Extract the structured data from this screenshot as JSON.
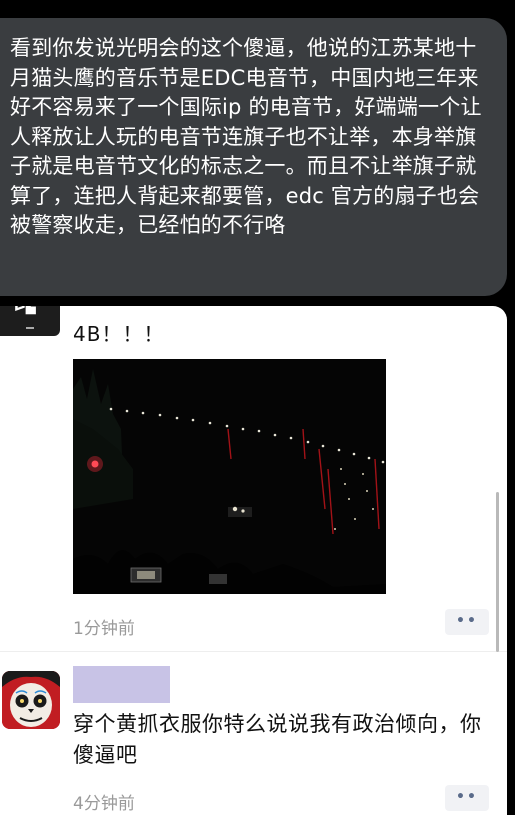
{
  "speech_bubble": {
    "text": "看到你发说光明会的这个傻逼，他说的江苏某地十月猫头鹰的音乐节是EDC电音节，中国内地三年来好不容易来了一个国际ip 的电音节，好端端一个让人释放让人玩的电音节连旗子也不让举，本身举旗子就是电音节文化的标志之一。而且不让举旗子就算了，连把人背起来都要管，edc 官方的扇子也会被警察收走，已经怕的不行咯"
  },
  "comments": [
    {
      "text": "4B！！！",
      "time": "1分钟前",
      "more_label": "••",
      "avatar_icon": "dark-logo-avatar",
      "photo_icon": "concert-night-photo"
    },
    {
      "text": "穿个黄抓衣服你特么说说我有政治倾向，你傻逼吧",
      "time": "4分钟前",
      "more_label": "••",
      "avatar_icon": "skull-face-avatar",
      "name_redacted": true
    }
  ],
  "colors": {
    "bubble_bg": "#3a3d40",
    "name_redaction": "#c8c3e6",
    "time_text": "#9a9a9a"
  }
}
